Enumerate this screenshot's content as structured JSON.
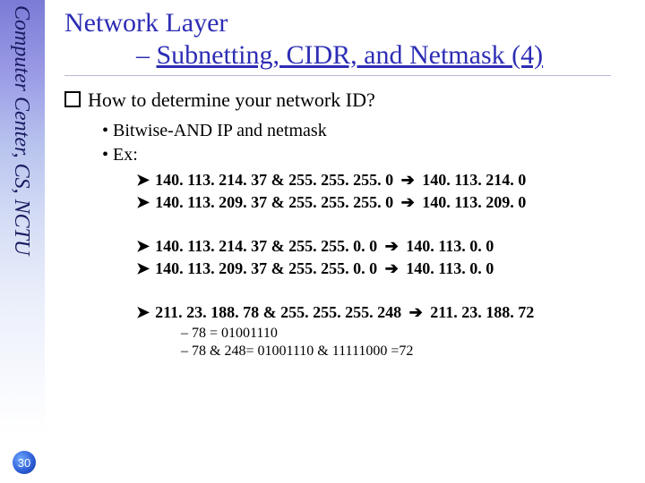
{
  "sidebar": {
    "text": "Computer Center, CS, NCTU",
    "page_number": "30"
  },
  "title": {
    "line1": "Network Layer",
    "dash": "–",
    "line2_underlined": "Subnetting, CIDR, and Netmask (4)"
  },
  "question": "How to determine your network ID?",
  "methods": [
    "Bitwise-AND IP and netmask",
    "Ex:"
  ],
  "ex1": [
    {
      "lhs": "140. 113. 214. 37 & 255. 255. 255. 0",
      "rhs": "140. 113. 214. 0"
    },
    {
      "lhs": "140. 113. 209. 37 & 255. 255. 255. 0",
      "rhs": "140. 113. 209. 0"
    }
  ],
  "ex2": [
    {
      "lhs": "140. 113. 214. 37 & 255. 255. 0. 0",
      "rhs": "140. 113. 0. 0"
    },
    {
      "lhs": "140. 113. 209. 37 & 255. 255. 0. 0",
      "rhs": "140. 113. 0. 0"
    }
  ],
  "ex3": [
    {
      "lhs": "211. 23. 188. 78 & 255. 255. 255. 248",
      "rhs": "211. 23. 188. 72"
    }
  ],
  "binary_lines": [
    "78 = 01001110",
    "78 & 248= 01001110 & 11111000 =72"
  ],
  "chart_data": null
}
